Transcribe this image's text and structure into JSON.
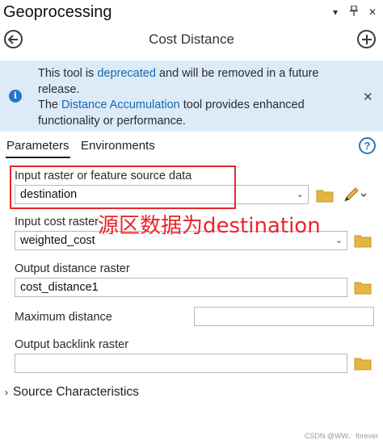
{
  "pane": {
    "title": "Geoprocessing"
  },
  "tool": {
    "title": "Cost Distance"
  },
  "banner": {
    "line1_pre": "This tool is ",
    "line1_link": "deprecated",
    "line1_post": " and will be removed in a future",
    "line2": "release.",
    "line3_pre": "The ",
    "line3_link": "Distance Accumulation",
    "line3_post": " tool provides enhanced",
    "line4": "functionality or performance."
  },
  "tabs": [
    {
      "label": "Parameters"
    },
    {
      "label": "Environments"
    }
  ],
  "fields": {
    "source": {
      "label": "Input raster or feature source data",
      "value": "destination"
    },
    "cost": {
      "label": "Input cost raster",
      "value": "weighted_cost"
    },
    "output_distance": {
      "label": "Output distance raster",
      "value": "cost_distance1"
    },
    "max_distance": {
      "label": "Maximum distance",
      "value": ""
    },
    "backlink": {
      "label": "Output backlink raster",
      "value": ""
    }
  },
  "annotation": {
    "text": "源区数据为destination"
  },
  "sections": {
    "source_characteristics": "Source Characteristics"
  },
  "watermark": "CSDN @WW、forever",
  "colors": {
    "accent": "#2a74c4",
    "banner_bg": "#dcebf7",
    "annotation": "#e8262a",
    "folder": "#e6b540"
  }
}
